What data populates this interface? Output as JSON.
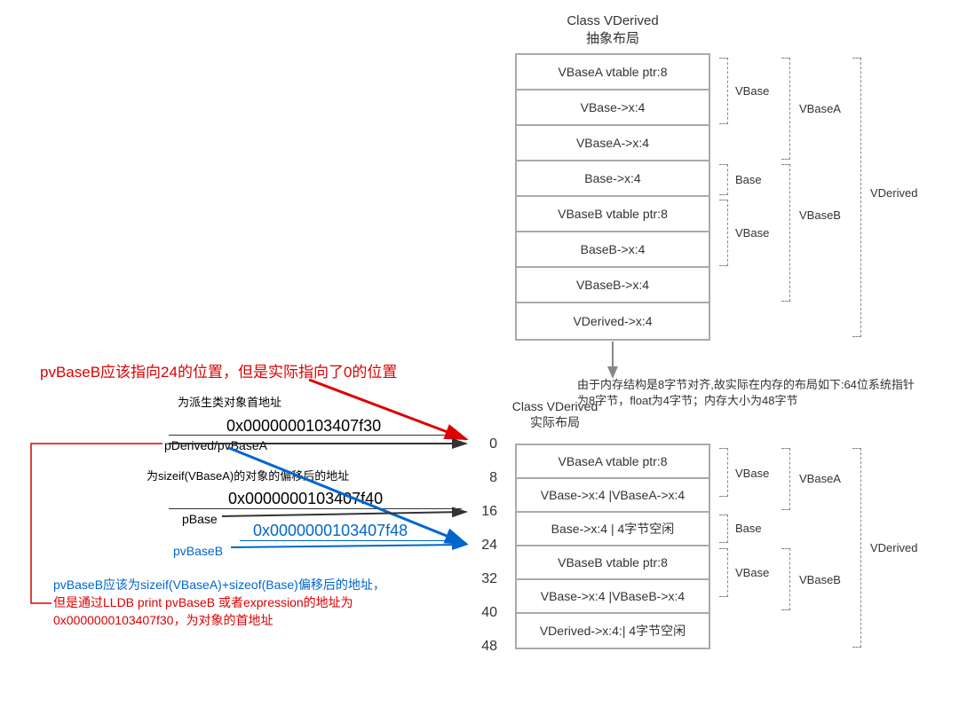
{
  "topDiagram": {
    "title1": "Class VDerived",
    "title2": "抽象布局",
    "rows": [
      "VBaseA vtable ptr:8",
      "VBase->x:4",
      "VBaseA->x:4",
      "Base->x:4",
      "VBaseB vtable ptr:8",
      "BaseB->x:4",
      "VBaseB->x:4",
      "VDerived->x:4"
    ],
    "brackets": {
      "vbase1": "VBase",
      "vbasea": "VBaseA",
      "base": "Base",
      "vbase2": "VBase",
      "vbaseb": "VBaseB",
      "vderived": "VDerived"
    }
  },
  "middleText": {
    "layout_note": "由于内存结构是8字节对齐,故实际在内存的布局如下:64位系统指针为8字节，float为4字节；内存大小为48字节",
    "actual_title1": "Class VDerived",
    "actual_title2": "实际布局"
  },
  "bottomDiagram": {
    "rows": [
      "VBaseA vtable ptr:8",
      "VBase->x:4 |VBaseA->x:4",
      "Base->x:4 | 4字节空闲",
      "VBaseB vtable ptr:8",
      "VBase->x:4 |VBaseB->x:4",
      "VDerived->x:4:| 4字节空闲"
    ],
    "brackets": {
      "vbase1": "VBase",
      "vbasea": "VBaseA",
      "base": "Base",
      "vbase2": "VBase",
      "vbaseb": "VBaseB",
      "vderived": "VDerived"
    },
    "offsets": [
      "0",
      "8",
      "16",
      "24",
      "32",
      "40",
      "48"
    ]
  },
  "annotations": {
    "red_title": "pvBaseB应该指向24的位置，但是实际指向了0的位置",
    "derived_note": "为派生类对象首地址",
    "addr1": "0x0000000103407f30",
    "label1": "pDerived/pvBaseA",
    "sizeof_note": "为sizeif(VBaseA)的对象的偏移后的地址",
    "addr2": "0x0000000103407f40",
    "label2": "pBase",
    "addr3": "0x0000000103407f48",
    "label3": "pvBaseB",
    "blue_note1": "pvBaseB应该为sizeif(VBaseA)+sizeof(Base)偏移后的地址，",
    "red_note2": "但是通过LLDB print pvBaseB 或者expression的地址为0x0000000103407f30，为对象的首地址"
  }
}
